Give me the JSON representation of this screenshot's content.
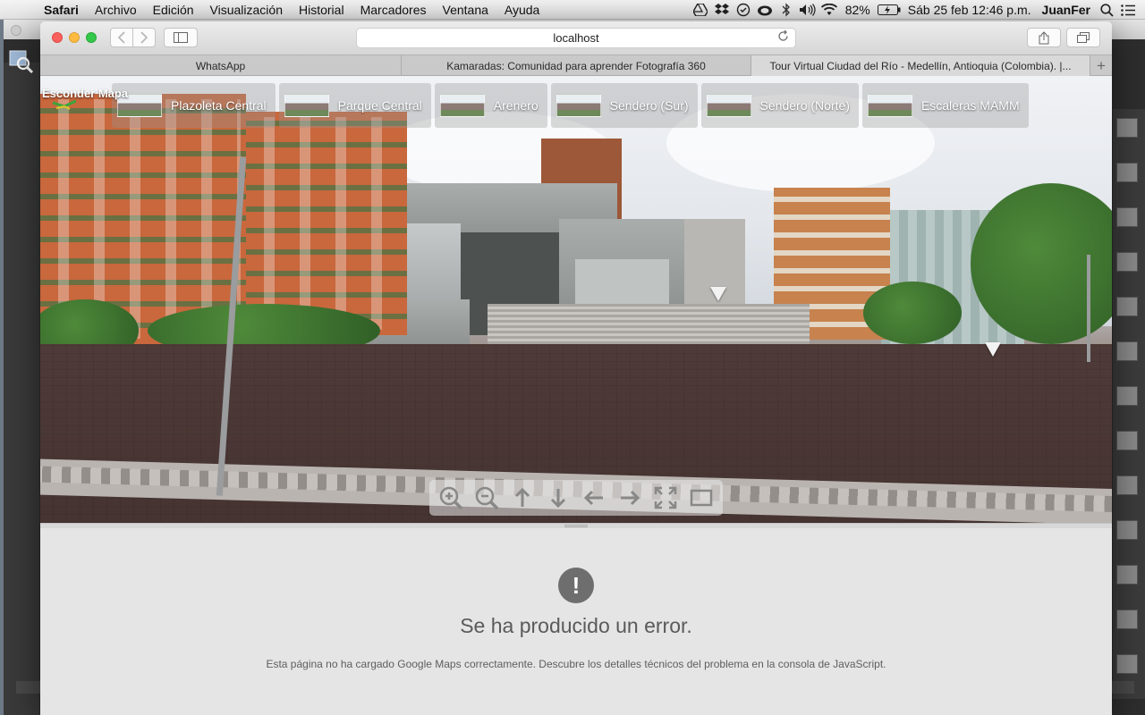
{
  "menubar": {
    "app": "Safari",
    "items": [
      "Archivo",
      "Edición",
      "Visualización",
      "Historial",
      "Marcadores",
      "Ventana",
      "Ayuda"
    ],
    "battery": "82%",
    "datetime": "Sáb 25 feb  12:46 p.m.",
    "user": "JuanFer",
    "status_icons": [
      "google-drive-icon",
      "dropbox-icon",
      "checkbox-icon",
      "creative-cloud-icon",
      "bluetooth-icon",
      "volume-icon",
      "wifi-icon",
      "battery-icon",
      "spotlight-icon",
      "notification-center-icon"
    ]
  },
  "browser": {
    "address": "localhost",
    "tabs": [
      "WhatsApp",
      "Kamaradas: Comunidad para aprender Fotografía 360",
      "Tour Virtual Ciudad del Río - Medellín, Antioquia (Colombia). |..."
    ],
    "new_tab": "+"
  },
  "viewer": {
    "hide_map_label": "Esconder Mapa",
    "scenes": [
      "Plazoleta Central",
      "Parque Central",
      "Arenero",
      "Sendero (Sur)",
      "Sendero (Norte)",
      "Escaleras MAMM"
    ],
    "controls": [
      "zoom-in-icon",
      "zoom-out-icon",
      "arrow-up-icon",
      "arrow-down-icon",
      "arrow-left-icon",
      "arrow-right-icon",
      "fullscreen-icon",
      "window-icon"
    ]
  },
  "map": {
    "error_icon": "!",
    "error_title": "Se ha producido un error.",
    "error_message": "Esta página no ha cargado Google Maps correctamente. Descubre los detalles técnicos del problema en la consola de JavaScript."
  }
}
